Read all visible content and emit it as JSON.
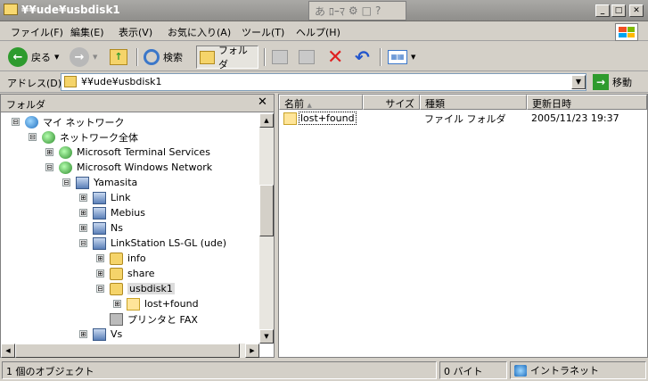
{
  "window": {
    "title": "¥¥ude¥usbdisk1",
    "ime_chars": "あ ﾛｰﾏ"
  },
  "menu": [
    "ファイル(F)",
    "編集(E)",
    "表示(V)",
    "お気に入り(A)",
    "ツール(T)",
    "ヘルプ(H)"
  ],
  "toolbar": {
    "back": "戻る",
    "search": "検索",
    "folders": "フォルダ"
  },
  "address": {
    "label": "アドレス(D)",
    "value": "¥¥ude¥usbdisk1",
    "go": "移動"
  },
  "folder_pane": {
    "title": "フォルダ",
    "tree": [
      {
        "label": "マイ ネットワーク",
        "expander": "⊟",
        "icon": "network-icon"
      },
      {
        "label": "ネットワーク全体",
        "expander": "⊟",
        "icon": "globe-icon"
      },
      {
        "label": "Microsoft Terminal Services",
        "expander": "⊞",
        "icon": "globe-icon"
      },
      {
        "label": "Microsoft Windows Network",
        "expander": "⊟",
        "icon": "globe-icon"
      },
      {
        "label": "Yamasita",
        "expander": "⊟",
        "icon": "workgroup-icon"
      },
      {
        "label": "Link",
        "expander": "⊞",
        "icon": "computer-icon"
      },
      {
        "label": "Mebius",
        "expander": "⊞",
        "icon": "computer-icon"
      },
      {
        "label": "Ns",
        "expander": "⊞",
        "icon": "computer-icon"
      },
      {
        "label": "LinkStation LS-GL (ude)",
        "expander": "⊟",
        "icon": "computer-icon"
      },
      {
        "label": "info",
        "expander": "⊞",
        "icon": "shared-folder-icon"
      },
      {
        "label": "share",
        "expander": "⊞",
        "icon": "shared-folder-icon"
      },
      {
        "label": "usbdisk1",
        "expander": "⊟",
        "icon": "shared-folder-icon"
      },
      {
        "label": "lost+found",
        "expander": "⊞",
        "icon": "folder-icon"
      },
      {
        "label": "プリンタと FAX",
        "expander": "",
        "icon": "printer-icon"
      },
      {
        "label": "Vs",
        "expander": "⊞",
        "icon": "computer-icon"
      }
    ]
  },
  "file_pane": {
    "columns": [
      "名前",
      "サイズ",
      "種類",
      "更新日時"
    ],
    "sort_indicator": "▲",
    "rows": [
      {
        "name": "lost+found",
        "size": "",
        "type": "ファイル フォルダ",
        "modified": "2005/11/23 19:37"
      }
    ]
  },
  "status": {
    "objects": "1 個のオブジェクト",
    "size": "0 バイト",
    "zone": "イントラネット"
  },
  "colors": {
    "titlebar": "#9c9b98",
    "chrome": "#d4d0c8",
    "selection": "#dcdcdc",
    "delete_red": "#e02020",
    "undo_blue": "#2255cc",
    "go_green": "#2e9b2e"
  }
}
